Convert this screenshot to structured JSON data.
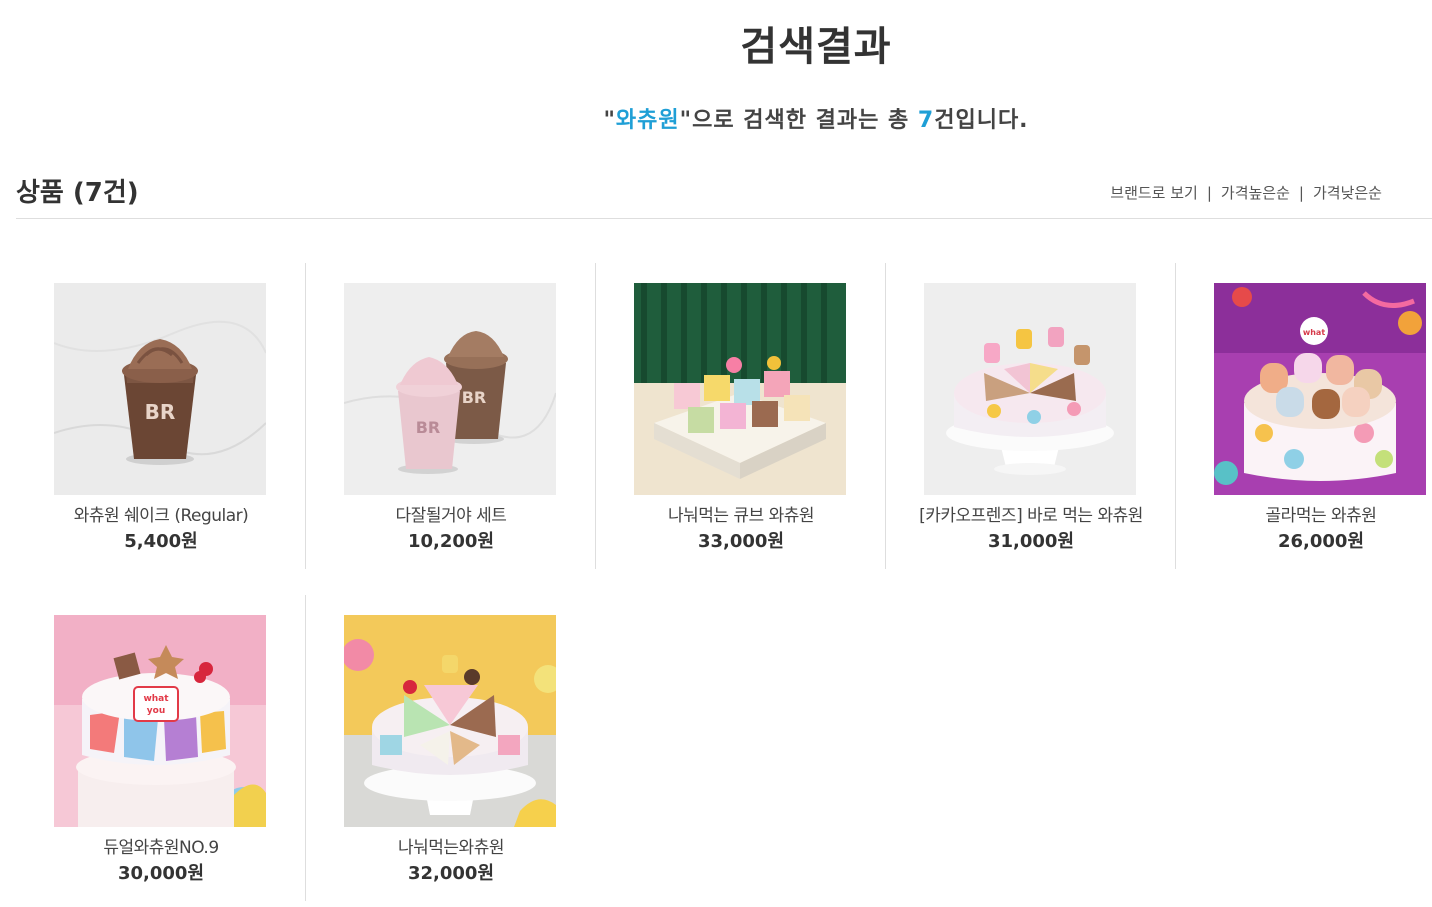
{
  "header": {
    "title": "검색결과",
    "summary_prefix": "\"",
    "keyword": "와츄원",
    "summary_middle": "\"으로 검색한 결과는 총 ",
    "count": "7",
    "summary_suffix": "건입니다."
  },
  "section": {
    "title": "상품 (7건)",
    "sort": {
      "brand": "브랜드로 보기",
      "high": "가격높은순",
      "low": "가격낮은순",
      "separator": "|"
    }
  },
  "products": [
    {
      "name": "와츄원 쉐이크 (Regular)",
      "price": "5,400원",
      "image": "chocolate-shake"
    },
    {
      "name": "다잘될거야 세트",
      "price": "10,200원",
      "image": "shake-set"
    },
    {
      "name": "나눠먹는 큐브 와츄원",
      "price": "33,000원",
      "image": "cube-cake"
    },
    {
      "name": "[카카오프렌즈] 바로 먹는 와츄원",
      "price": "31,000원",
      "image": "kakao-cake"
    },
    {
      "name": "골라먹는 와츄원",
      "price": "26,000원",
      "image": "pick-cake"
    },
    {
      "name": "듀얼와츄원NO.9",
      "price": "30,000원",
      "image": "dual-cake"
    },
    {
      "name": "나눠먹는와츄원",
      "price": "32,000원",
      "image": "share-cake"
    }
  ],
  "colors": {
    "accent": "#1f9fd6",
    "text": "#333333",
    "divider": "#dedede"
  }
}
